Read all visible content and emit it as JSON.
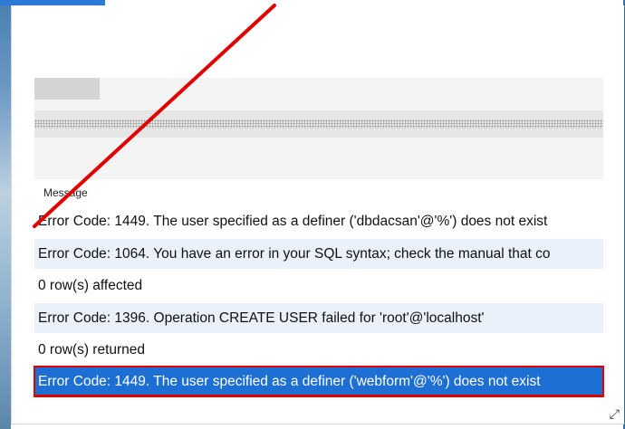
{
  "results": {
    "column_header": "Message",
    "rows": [
      {
        "text": "Error Code: 1449. The user specified as a definer ('dbdacsan'@'%') does not exist"
      },
      {
        "text": "Error Code: 1064. You have an error in your SQL syntax; check the manual that co"
      },
      {
        "text": "0 row(s) affected"
      },
      {
        "text": "Error Code: 1396. Operation CREATE USER failed for 'root'@'localhost'"
      },
      {
        "text": "0 row(s) returned"
      },
      {
        "text": "Error Code: 1449. The user specified as a definer ('webform'@'%') does not exist"
      }
    ],
    "selected_row": 5
  },
  "colors": {
    "selection": "#1e6fd4",
    "annotation": "#e00000",
    "alt_row": "#eaf1fb"
  },
  "icons": {
    "resize": "resize-icon"
  }
}
